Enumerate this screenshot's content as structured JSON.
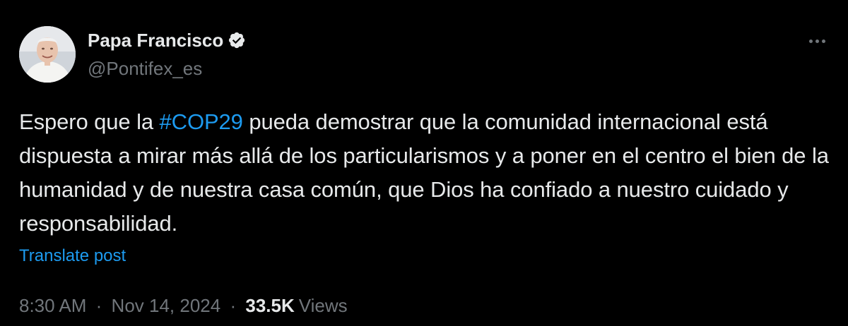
{
  "author": {
    "name": "Papa Francisco",
    "handle": "@Pontifex_es",
    "verified_icon": "verified-badge-icon",
    "avatar_icon": "profile-photo"
  },
  "post": {
    "text_before": "Espero que la ",
    "hashtag": "#COP29",
    "text_after": " pueda demostrar que la comunidad internacional está dispuesta a mirar más allá de los particularismos y a poner en el centro el bien de la humanidad y de nuestra casa común, que Dios ha confiado a nuestro cuidado y responsabilidad."
  },
  "translate_label": "Translate post",
  "meta": {
    "time": "8:30 AM",
    "separator": "·",
    "date": "Nov 14, 2024",
    "views_count": "33.5K",
    "views_label": "Views"
  },
  "more_icon": "more-options-icon",
  "colors": {
    "background": "#000000",
    "text": "#e7e9ea",
    "secondary": "#71767b",
    "accent": "#1d9bf0"
  }
}
